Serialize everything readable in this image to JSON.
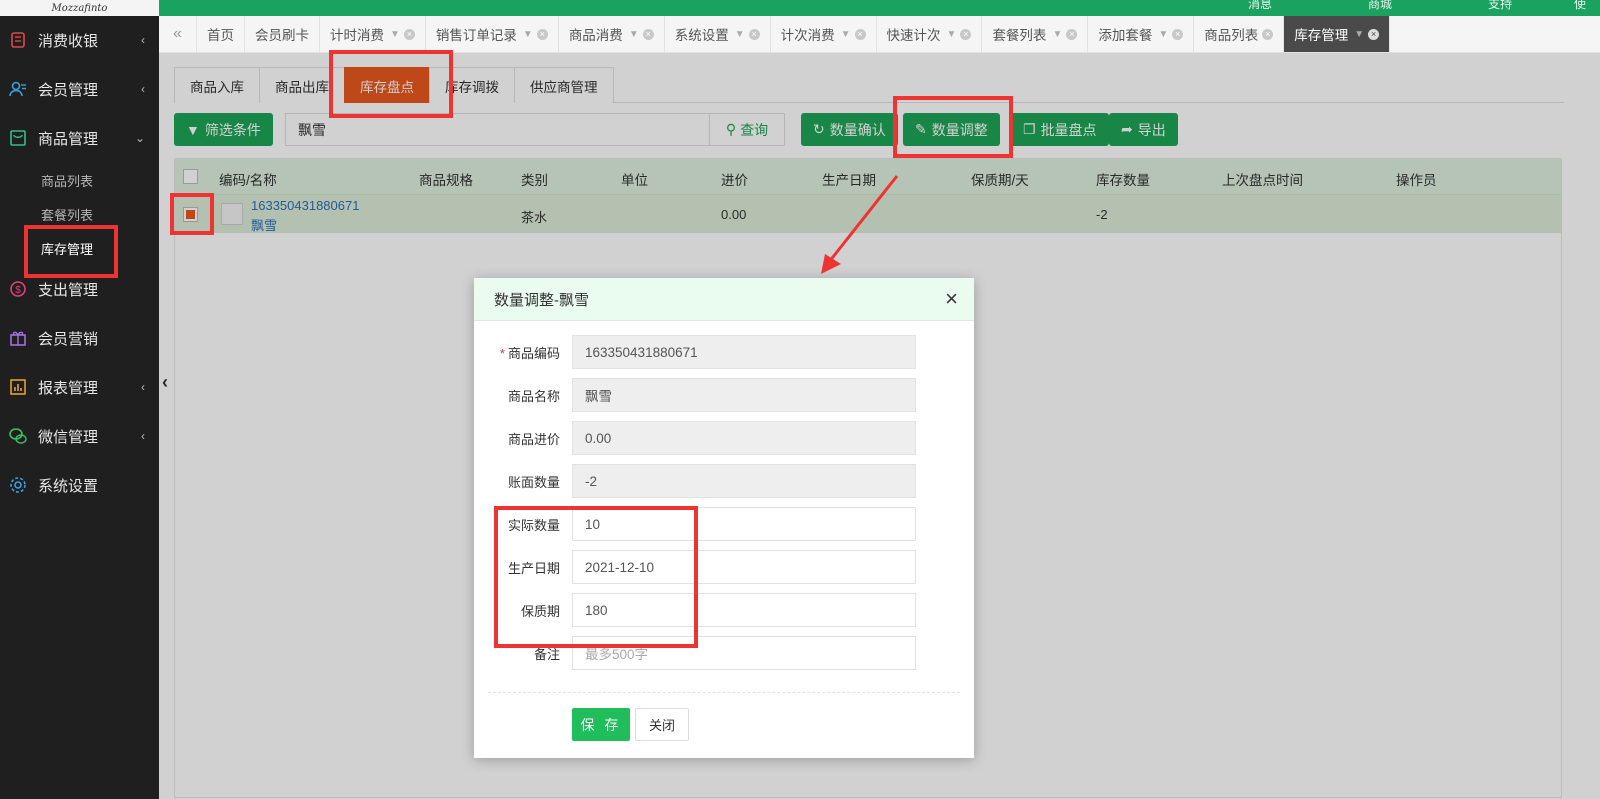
{
  "app": {
    "logo_text": "Mozzafinto",
    "top_links": [
      "消息",
      "商城",
      "支持",
      "使"
    ]
  },
  "sidebar": {
    "items": [
      {
        "label": "消费收银",
        "icon": "cash-register-icon"
      },
      {
        "label": "会员管理",
        "icon": "members-icon"
      },
      {
        "label": "商品管理",
        "icon": "goods-icon"
      },
      {
        "label": "支出管理",
        "icon": "expense-icon"
      },
      {
        "label": "会员营销",
        "icon": "gift-icon"
      },
      {
        "label": "报表管理",
        "icon": "chart-icon"
      },
      {
        "label": "微信管理",
        "icon": "wechat-icon"
      },
      {
        "label": "系统设置",
        "icon": "gear-icon"
      }
    ],
    "sub_items": [
      "商品列表",
      "套餐列表",
      "库存管理"
    ]
  },
  "tabs": [
    "首页",
    "会员刷卡",
    "计时消费",
    "销售订单记录",
    "商品消费",
    "系统设置",
    "计次消费",
    "快速计次",
    "套餐列表",
    "添加套餐",
    "商品列表",
    "库存管理"
  ],
  "subtabs": [
    "商品入库",
    "商品出库",
    "库存盘点",
    "库存调拨",
    "供应商管理"
  ],
  "toolbar": {
    "filter_label": "筛选条件",
    "search_value": "飘雪",
    "search_label": "查询",
    "confirm_label": "数量确认",
    "adjust_label": "数量调整",
    "batch_label": "批量盘点",
    "export_label": "导出"
  },
  "table": {
    "headers": [
      "编码/名称",
      "商品规格",
      "类别",
      "单位",
      "进价",
      "生产日期",
      "保质期/天",
      "库存数量",
      "上次盘点时间",
      "操作员"
    ],
    "rows": [
      {
        "code": "163350431880671",
        "name": "飘雪",
        "spec": "",
        "category": "茶水",
        "unit": "",
        "price": "0.00",
        "prod_date": "",
        "shelf_life": "",
        "stock": "-2",
        "last_check": "",
        "operator": ""
      }
    ]
  },
  "modal": {
    "title": "数量调整-飘雪",
    "fields": [
      {
        "label": "商品编码",
        "value": "163350431880671",
        "required": true
      },
      {
        "label": "商品名称",
        "value": "飘雪"
      },
      {
        "label": "商品进价",
        "value": "0.00"
      },
      {
        "label": "账面数量",
        "value": "-2"
      },
      {
        "label": "实际数量",
        "value": "10"
      },
      {
        "label": "生产日期",
        "value": "2021-12-10"
      },
      {
        "label": "保质期",
        "value": "180"
      },
      {
        "label": "备注",
        "placeholder": "最多500字"
      }
    ],
    "save_label": "保 存",
    "close_label": "关闭",
    "required_mark": "*"
  },
  "colors": {
    "green": "#1ea456",
    "orange": "#e8581d",
    "annotation_red": "#ee3333",
    "sidebar_bg": "#1f1f1f"
  }
}
